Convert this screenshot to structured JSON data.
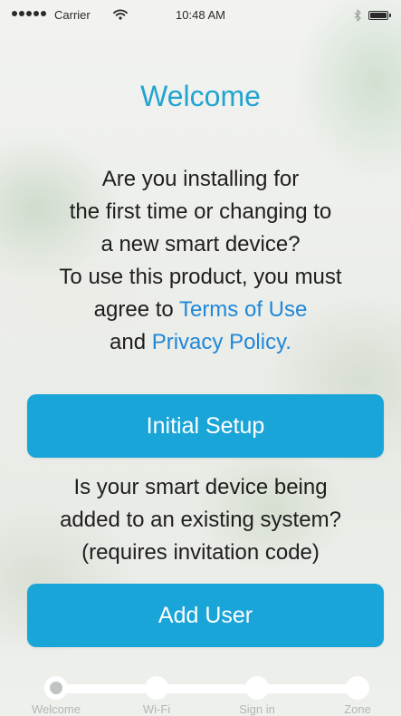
{
  "status_bar": {
    "carrier": "Carrier",
    "time": "10:48 AM",
    "signal_bars": 5
  },
  "title": "Welcome",
  "intro": {
    "line1": "Are you installing for",
    "line2": "the first time or changing to",
    "line3": "a new smart device?",
    "line4": "To use this product, you must",
    "line5_prefix": "agree to ",
    "terms_link": "Terms of Use",
    "line6_prefix": "and ",
    "privacy_link": "Privacy Policy."
  },
  "initial_setup_button": "Initial Setup",
  "question": {
    "line1": "Is your smart device being",
    "line2": "added to an existing system?",
    "line3": "(requires invitation code)"
  },
  "add_user_button": "Add User",
  "progress_steps": [
    {
      "label": "Welcome",
      "active": true
    },
    {
      "label": "Wi-Fi",
      "active": false
    },
    {
      "label": "Sign in",
      "active": false
    },
    {
      "label": "Zone",
      "active": false
    }
  ],
  "colors": {
    "accent": "#21a4cf",
    "button": "#1aa5d8",
    "link": "#1f87d8",
    "text": "#1e1e1e"
  },
  "icons": [
    "signal-dots-icon",
    "wifi-icon",
    "bluetooth-icon",
    "battery-icon"
  ]
}
